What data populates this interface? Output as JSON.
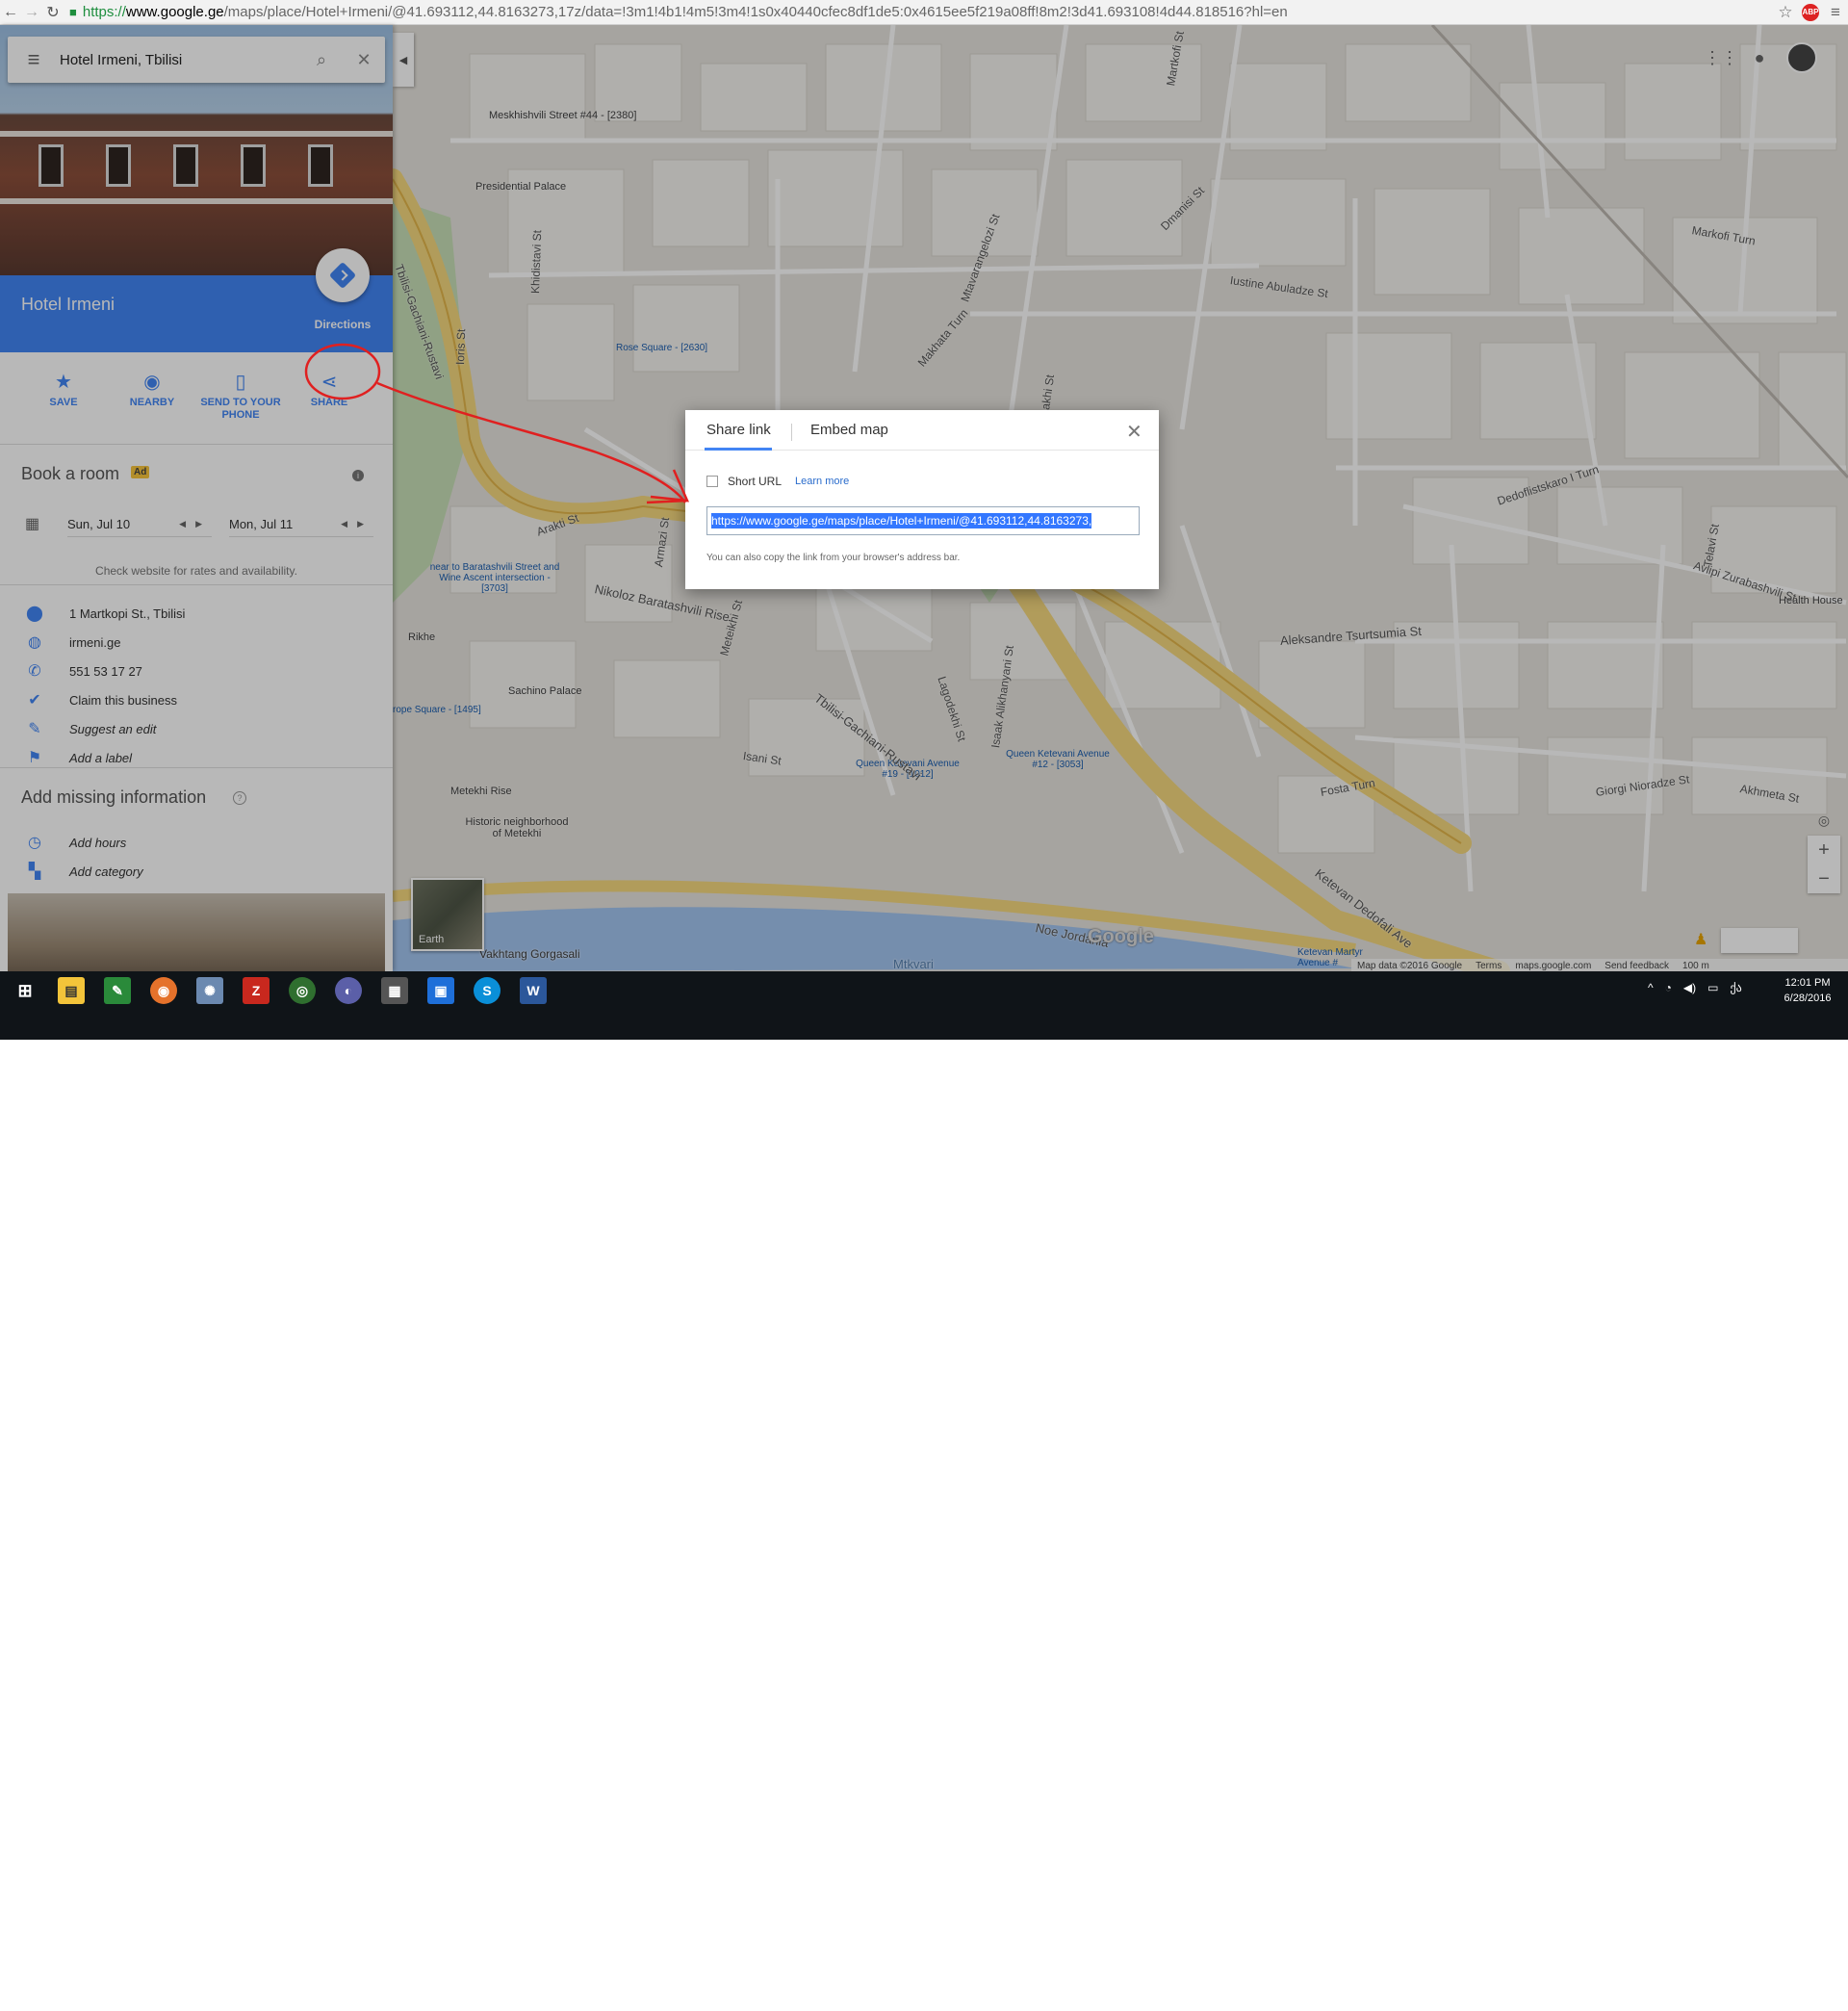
{
  "browser": {
    "url_proto": "https://",
    "url_host": "www.google.ge",
    "url_path": "/maps/place/Hotel+Irmeni/@41.693112,44.8163273,17z/data=!3m1!4b1!4m5!3m4!1s0x40440cfec8df1de5:0x4615ee5f219a08ff!8m2!3d41.693108!4d44.818516?hl=en",
    "abp_label": "ABP"
  },
  "search": {
    "query": "Hotel Irmeni, Tbilisi"
  },
  "place": {
    "title": "Hotel Irmeni",
    "directions_label": "Directions",
    "actions": [
      {
        "label": "SAVE",
        "icon": "star-icon",
        "glyph": "★"
      },
      {
        "label": "NEARBY",
        "icon": "nearby-icon",
        "glyph": "◉"
      },
      {
        "label": "SEND TO YOUR PHONE",
        "icon": "send-to-phone-icon",
        "glyph": "▯"
      },
      {
        "label": "SHARE",
        "icon": "share-icon",
        "glyph": "⋖"
      }
    ],
    "book": {
      "title": "Book a room",
      "ad_badge": "Ad",
      "checkin": "Sun, Jul 10",
      "checkout": "Mon, Jul 11",
      "note": "Check website for rates and availability."
    },
    "details": [
      {
        "icon": "pin-icon",
        "glyph": "⬤",
        "text": "1 Martkopi St., Tbilisi",
        "italic": false
      },
      {
        "icon": "globe-icon",
        "glyph": "◍",
        "text": "irmeni.ge",
        "italic": false
      },
      {
        "icon": "phone-icon",
        "glyph": "✆",
        "text": "551 53 17 27",
        "italic": false
      },
      {
        "icon": "verified-icon",
        "glyph": "✔",
        "text": "Claim this business",
        "italic": false
      },
      {
        "icon": "pencil-icon",
        "glyph": "✎",
        "text": "Suggest an edit",
        "italic": true
      },
      {
        "icon": "flag-icon",
        "glyph": "⚑",
        "text": "Add a label",
        "italic": true
      }
    ],
    "missing": {
      "title": "Add missing information",
      "items": [
        {
          "icon": "clock-icon",
          "glyph": "◷",
          "text": "Add hours"
        },
        {
          "icon": "category-icon",
          "glyph": "▚",
          "text": "Add category"
        }
      ]
    }
  },
  "dialog": {
    "tab_share": "Share link",
    "tab_embed": "Embed map",
    "short_url_label": "Short URL",
    "learn_more": "Learn more",
    "link_value": "https://www.google.ge/maps/place/Hotel+Irmeni/@41.693112,44.8163273,",
    "hint": "You can also copy the link from your browser's address bar."
  },
  "map": {
    "earth_label": "Earth",
    "google_logo": "Google",
    "attribution": [
      "Map data ©2016 Google",
      "Terms",
      "maps.google.com",
      "Send feedback",
      "100 m"
    ],
    "labels": [
      "Meskhishvili Street #44 - [2380]",
      "Presidential Palace",
      "Rose Square - [2630]",
      "near to Baratashvili Street and Wine Ascent intersection - [3703]",
      "Rikhe",
      "Sachino Palace",
      "rope Square - [1495]",
      "Metekhi Rise",
      "Historic neighborhood of Metekhi",
      "Queen Ketevani Avenue #19 - [1012]",
      "Queen Ketevani Avenue #12 - [3053]",
      "Ketevan Martyr Avenue #",
      "Health House",
      "Vakhtang Gorgasali",
      "Mtkvari"
    ],
    "streets": [
      "Tbilisi-Gachiani-Rustavi",
      "Nikoloz Baratashvili Rise",
      "Tbilisi-Gachiani-Rustavi",
      "Aleksandre Tsurtsumia St",
      "Ketevan Dedofali Ave",
      "Noe Jordania",
      "Iustine Abuladze St",
      "Markofi Turn",
      "Dmanisi St",
      "Martkofi St",
      "Makhata Turn",
      "Dedoflistskaro I Turn",
      "Avlipi Zurabashvili St",
      "Akhmeta St",
      "Giorgi Nioradze St",
      "Fosta Turn",
      "Isani St",
      "Arakti St",
      "Ioris St",
      "Khidistavi St",
      "Nikiforo Irbakhi St",
      "Isaak Alikhanyani St",
      "Lagodekhi St",
      "Meteikhi St",
      "Armazi St",
      "Telavi St",
      "Mtavarangelozi St"
    ]
  },
  "taskbar": {
    "time": "12:01 PM",
    "date": "6/28/2016"
  }
}
